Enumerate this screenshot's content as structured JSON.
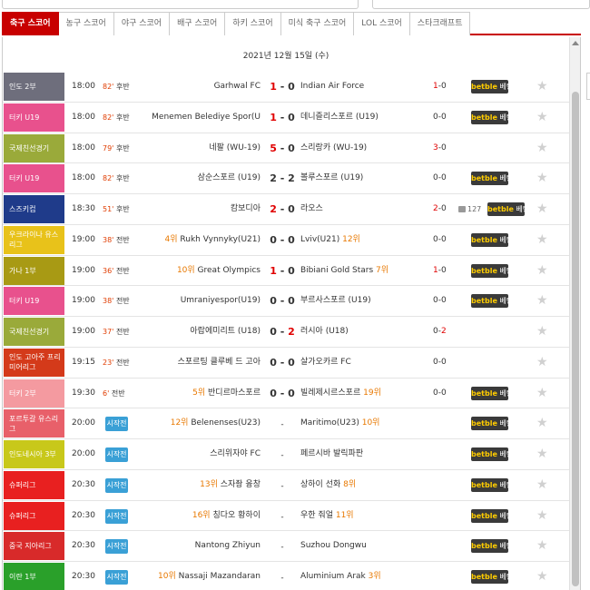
{
  "tabs": [
    {
      "label": "축구 스코어",
      "active": true
    },
    {
      "label": "농구 스코어",
      "active": false
    },
    {
      "label": "야구 스코어",
      "active": false
    },
    {
      "label": "배구 스코어",
      "active": false
    },
    {
      "label": "하키 스코어",
      "active": false
    },
    {
      "label": "미식 축구 스코어",
      "active": false
    },
    {
      "label": "LOL 스코어",
      "active": false
    },
    {
      "label": "스타크래프트",
      "active": false
    }
  ],
  "date_header": "2021년 12월 15일 (수)",
  "bet_label": {
    "brand": "betble",
    "suffix": "베팅"
  },
  "start_label": "시작전",
  "star_icon": "star-icon",
  "colors": {
    "accent": "#c80000",
    "score_red": "#e00000",
    "minute": "#e03c00",
    "rank": "#e87800",
    "start_button": "#3aa0d6"
  },
  "matches": [
    {
      "league": "인도 2부",
      "color": "#6e6e7c",
      "time": "18:00",
      "minute": "82'",
      "period": "후반",
      "home": "Garhwal FC",
      "home_rank": "",
      "score_home": "1",
      "score_away": "0",
      "away": "Indian Air Force",
      "away_rank": "",
      "ht_home": "1",
      "ht_away": "0",
      "comments": "",
      "bet": true,
      "start": false,
      "red_home": true,
      "red_away": false,
      "ht_red_home": true,
      "ht_red_away": false
    },
    {
      "league": "터키 U19",
      "color": "#e8518d",
      "time": "18:00",
      "minute": "82'",
      "period": "후반",
      "home": "Menemen Belediye Spor(U",
      "home_rank": "",
      "score_home": "1",
      "score_away": "0",
      "away": "데니즐리스포르 (U19)",
      "away_rank": "",
      "ht_home": "0",
      "ht_away": "0",
      "comments": "",
      "bet": true,
      "start": false,
      "red_home": true,
      "red_away": false,
      "ht_red_home": false,
      "ht_red_away": false
    },
    {
      "league": "국제친선경기",
      "color": "#9aaa3a",
      "time": "18:00",
      "minute": "79'",
      "period": "후반",
      "home": "네팔 (WU-19)",
      "home_rank": "",
      "score_home": "5",
      "score_away": "0",
      "away": "스리랑카 (WU-19)",
      "away_rank": "",
      "ht_home": "3",
      "ht_away": "0",
      "comments": "",
      "bet": false,
      "start": false,
      "red_home": true,
      "red_away": false,
      "ht_red_home": true,
      "ht_red_away": false
    },
    {
      "league": "터키 U19",
      "color": "#e8518d",
      "time": "18:00",
      "minute": "82'",
      "period": "후반",
      "home": "삼순스포르 (U19)",
      "home_rank": "",
      "score_home": "2",
      "score_away": "2",
      "away": "볼루스포르 (U19)",
      "away_rank": "",
      "ht_home": "0",
      "ht_away": "0",
      "comments": "",
      "bet": true,
      "start": false,
      "red_home": false,
      "red_away": false,
      "ht_red_home": false,
      "ht_red_away": false
    },
    {
      "league": "스즈키컵",
      "color": "#1f3b8a",
      "time": "18:30",
      "minute": "51'",
      "period": "후반",
      "home": "캄보디아",
      "home_rank": "",
      "score_home": "2",
      "score_away": "0",
      "away": "라오스",
      "away_rank": "",
      "ht_home": "2",
      "ht_away": "0",
      "comments": "127",
      "bet": true,
      "start": false,
      "red_home": true,
      "red_away": false,
      "ht_red_home": true,
      "ht_red_away": false
    },
    {
      "league": "우크라이나 유스리그",
      "color": "#e8c21a",
      "time": "19:00",
      "minute": "38'",
      "period": "전반",
      "home": "Rukh Vynnyky(U21)",
      "home_rank": "4위",
      "score_home": "0",
      "score_away": "0",
      "away": "Lviv(U21)",
      "away_rank": "12위",
      "ht_home": "0",
      "ht_away": "0",
      "comments": "",
      "bet": true,
      "start": false,
      "red_home": false,
      "red_away": false,
      "ht_red_home": false,
      "ht_red_away": false
    },
    {
      "league": "가나 1부",
      "color": "#a89a14",
      "time": "19:00",
      "minute": "36'",
      "period": "전반",
      "home": "Great Olympics",
      "home_rank": "10위",
      "score_home": "1",
      "score_away": "0",
      "away": "Bibiani Gold Stars",
      "away_rank": "7위",
      "ht_home": "1",
      "ht_away": "0",
      "comments": "",
      "bet": true,
      "start": false,
      "red_home": true,
      "red_away": false,
      "ht_red_home": true,
      "ht_red_away": false
    },
    {
      "league": "터키 U19",
      "color": "#e8518d",
      "time": "19:00",
      "minute": "38'",
      "period": "전반",
      "home": "Umraniyespor(U19)",
      "home_rank": "",
      "score_home": "0",
      "score_away": "0",
      "away": "부르사스포르 (U19)",
      "away_rank": "",
      "ht_home": "0",
      "ht_away": "0",
      "comments": "",
      "bet": true,
      "start": false,
      "red_home": false,
      "red_away": false,
      "ht_red_home": false,
      "ht_red_away": false
    },
    {
      "league": "국제친선경기",
      "color": "#9aaa3a",
      "time": "19:00",
      "minute": "37'",
      "period": "전반",
      "home": "아랍에미리트 (U18)",
      "home_rank": "",
      "score_home": "0",
      "score_away": "2",
      "away": "러시아 (U18)",
      "away_rank": "",
      "ht_home": "0",
      "ht_away": "2",
      "comments": "",
      "bet": false,
      "start": false,
      "red_home": false,
      "red_away": true,
      "ht_red_home": false,
      "ht_red_away": true
    },
    {
      "league": "인도 고아주 프리미어리그",
      "color": "#d43a1a",
      "time": "19:15",
      "minute": "23'",
      "period": "전반",
      "home": "스포르팅 클루베 드 고아",
      "home_rank": "",
      "score_home": "0",
      "score_away": "0",
      "away": "살가오카르 FC",
      "away_rank": "",
      "ht_home": "0",
      "ht_away": "0",
      "comments": "",
      "bet": false,
      "start": false,
      "red_home": false,
      "red_away": false,
      "ht_red_home": false,
      "ht_red_away": false
    },
    {
      "league": "터키 2부",
      "color": "#f49aa0",
      "time": "19:30",
      "minute": "6'",
      "period": "전반",
      "home": "반디르마스포르",
      "home_rank": "5위",
      "score_home": "0",
      "score_away": "0",
      "away": "빌레제시르스포르",
      "away_rank": "19위",
      "ht_home": "0",
      "ht_away": "0",
      "comments": "",
      "bet": true,
      "start": false,
      "red_home": false,
      "red_away": false,
      "ht_red_home": false,
      "ht_red_away": false
    },
    {
      "league": "포르투갈 유스리그",
      "color": "#e8606a",
      "time": "20:00",
      "minute": "",
      "period": "",
      "home": "Belenenses(U23)",
      "home_rank": "12위",
      "score_home": "",
      "score_away": "",
      "away": "Maritimo(U23)",
      "away_rank": "10위",
      "ht_home": "",
      "ht_away": "",
      "comments": "",
      "bet": true,
      "start": true,
      "red_home": false,
      "red_away": false,
      "ht_red_home": false,
      "ht_red_away": false
    },
    {
      "league": "인도네시아 3부",
      "color": "#c8c81a",
      "time": "20:00",
      "minute": "",
      "period": "",
      "home": "스리위자야 FC",
      "home_rank": "",
      "score_home": "",
      "score_away": "",
      "away": "페르시바 발릭파판",
      "away_rank": "",
      "ht_home": "",
      "ht_away": "",
      "comments": "",
      "bet": true,
      "start": true,
      "red_home": false,
      "red_away": false,
      "ht_red_home": false,
      "ht_red_away": false
    },
    {
      "league": "슈퍼리그",
      "color": "#e82020",
      "time": "20:30",
      "minute": "",
      "period": "",
      "home": "스자좡 융창",
      "home_rank": "13위",
      "score_home": "",
      "score_away": "",
      "away": "상하이 선화",
      "away_rank": "8위",
      "ht_home": "",
      "ht_away": "",
      "comments": "",
      "bet": true,
      "start": true,
      "red_home": false,
      "red_away": false,
      "ht_red_home": false,
      "ht_red_away": false
    },
    {
      "league": "슈퍼리그",
      "color": "#e82020",
      "time": "20:30",
      "minute": "",
      "period": "",
      "home": "칭다오 황하이",
      "home_rank": "16위",
      "score_home": "",
      "score_away": "",
      "away": "우한 줘얼",
      "away_rank": "11위",
      "ht_home": "",
      "ht_away": "",
      "comments": "",
      "bet": true,
      "start": true,
      "red_home": false,
      "red_away": false,
      "ht_red_home": false,
      "ht_red_away": false
    },
    {
      "league": "중국 지아리그",
      "color": "#d82a2a",
      "time": "20:30",
      "minute": "",
      "period": "",
      "home": "Nantong Zhiyun",
      "home_rank": "",
      "score_home": "",
      "score_away": "",
      "away": "Suzhou Dongwu",
      "away_rank": "",
      "ht_home": "",
      "ht_away": "",
      "comments": "",
      "bet": true,
      "start": true,
      "red_home": false,
      "red_away": false,
      "ht_red_home": false,
      "ht_red_away": false
    },
    {
      "league": "이란 1부",
      "color": "#2aa02a",
      "time": "20:30",
      "minute": "",
      "period": "",
      "home": "Nassaji Mazandaran",
      "home_rank": "10위",
      "score_home": "",
      "score_away": "",
      "away": "Aluminium Arak",
      "away_rank": "3위",
      "ht_home": "",
      "ht_away": "",
      "comments": "",
      "bet": true,
      "start": true,
      "red_home": false,
      "red_away": false,
      "ht_red_home": false,
      "ht_red_away": false
    }
  ]
}
